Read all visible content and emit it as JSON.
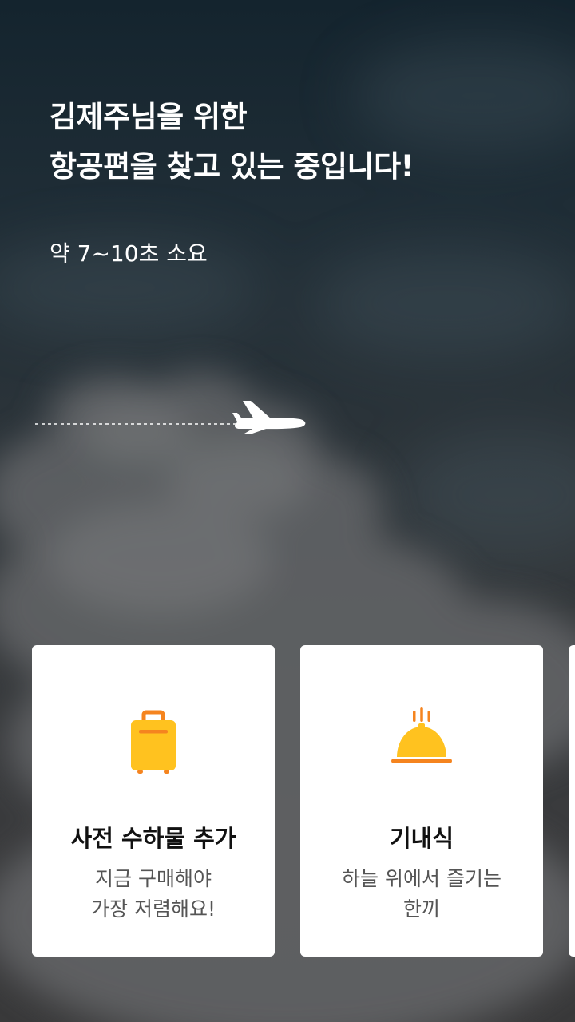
{
  "headline": {
    "line1": "김제주님을 위한",
    "line2": "항공편을 찾고 있는 중입니다!"
  },
  "subtext": "약 7~10초 소요",
  "colors": {
    "background_top": "#14242e",
    "background_bottom": "#39393a",
    "card_background": "#ffffff",
    "icon_yellow": "#ffc21f",
    "icon_orange": "#f5841f"
  },
  "cards": [
    {
      "icon": "suitcase-icon",
      "title": "사전 수하물 추가",
      "desc_line1": "지금 구매해야",
      "desc_line2": "가장 저렴해요!"
    },
    {
      "icon": "meal-cloche-icon",
      "title": "기내식",
      "desc_line1": "하늘 위에서 즐기는",
      "desc_line2": "한끼"
    }
  ]
}
